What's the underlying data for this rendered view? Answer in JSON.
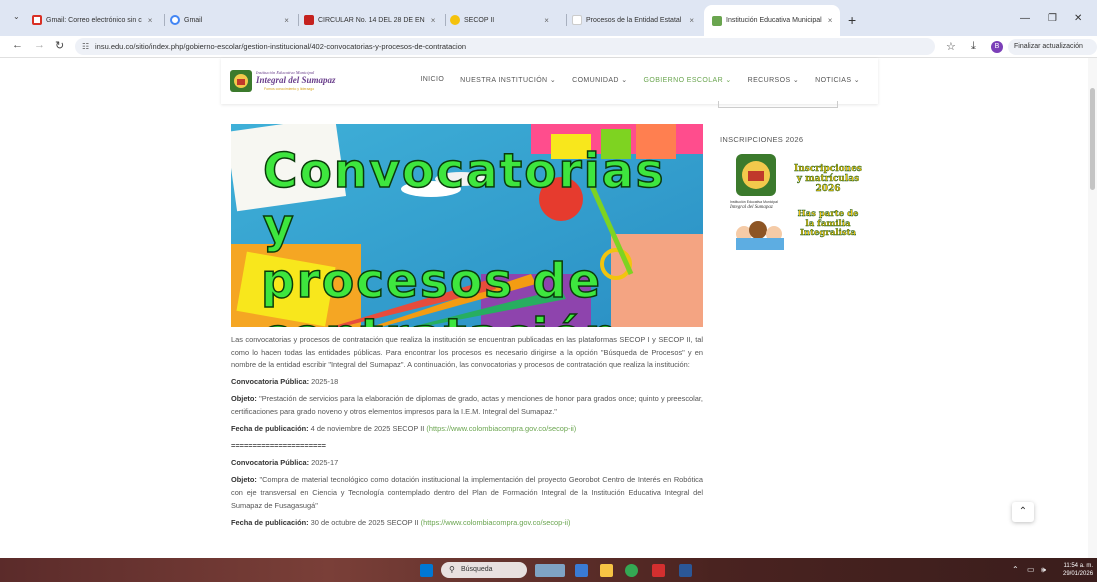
{
  "browser": {
    "tabs": [
      {
        "title": "Gmail: Correo electrónico sin c",
        "color": "#d93025"
      },
      {
        "title": "Gmail",
        "color": "#4285f4"
      },
      {
        "title": "CIRCULAR No. 14 DEL 28 DE EN",
        "color": "#c5221f"
      },
      {
        "title": "SECOP II",
        "color": "#f4c20d"
      },
      {
        "title": "Procesos de la Entidad Estatal",
        "color": "#ffffff"
      },
      {
        "title": "Institución Educativa Municipal",
        "color": "#6aa54f"
      }
    ],
    "close_glyph": "×",
    "new_tab_glyph": "+",
    "url": "insu.edu.co/sitio/index.php/gobierno-escolar/gestion-institucional/402-convocatorias-y-procesos-de-contratacion",
    "profile_initial": "B",
    "update_label": "Finalizar actualización"
  },
  "site": {
    "logo_title": "Institución Educativa Municipal",
    "logo_name": "Integral del Sumapaz",
    "logo_tagline": "Fomos conocimiento y liderazgo",
    "nav": [
      "INICIO",
      "NUESTRA INSTITUCIÓN ⌄",
      "COMUNIDAD ⌄",
      "GOBIERNO ESCOLAR ⌄",
      "RECURSOS ⌄",
      "NOTICIAS ⌄"
    ],
    "active_nav_index": 3,
    "accent_color": "#6aa54f"
  },
  "hero": {
    "line1": "Convocatorias y",
    "line2": "procesos de",
    "line3": "contratación"
  },
  "article": {
    "intro": "Las convocatorias y procesos de contratación que realiza la institución se encuentran publicadas en las plataformas SECOP I y SECOP II, tal como lo hacen todas las entidades públicas. Para encontrar los procesos es necesario dirigirse a la opción \"Búsqueda de Procesos\" y en nombre de la entidad escribir \"Integral del Sumapaz\". A continuación, las convocatorias y procesos de contratación que realiza la institución:",
    "items": [
      {
        "conv_label": "Convocatoria Pública:",
        "conv_value": " 2025-18",
        "obj_label": "Objeto:",
        "obj_value": " \"Prestación de servicios para la elaboración de diplomas de grado, actas y menciones de honor para grados once; quinto y preescolar, certificaciones para grado noveno y otros elementos impresos para la I.E.M. Integral del Sumapaz.\"",
        "date_label": "Fecha de publicación:",
        "date_value": " 4 de noviembre de 2025 SECOP II ",
        "link": "(https://www.colombiacompra.gov.co/secop-ii)"
      },
      {
        "conv_label": "Convocatoria Pública:",
        "conv_value": " 2025-17",
        "obj_label": "Objeto:",
        "obj_value": " \"Compra de material tecnológico como dotación institucional la implementación del proyecto Georobot Centro de Interés en Robótica con eje transversal en Ciencia y Tecnología contemplado dentro del Plan de Formación Integral de la Institución Educativa Integral del Sumapaz de Fusagasugá\"",
        "date_label": "Fecha de publicación:",
        "date_value": " 30 de octubre de 2025 SECOP II ",
        "link": "(https://www.colombiacompra.gov.co/secop-ii)"
      }
    ],
    "separator": "======================"
  },
  "sidebar": {
    "title": "INSCRIPCIONES 2026",
    "promo_line1": "Inscripciones",
    "promo_line2": "y matrículas",
    "promo_line3": "2026",
    "promo_line4": "Has parte de",
    "promo_line5": "la familia",
    "promo_line6": "Integralista",
    "promo_school": "Institución Educativa Municipal",
    "promo_school2": "Integral del Sumapaz"
  },
  "taskbar": {
    "search_placeholder": "Búsqueda",
    "time": "11:54 a. m.",
    "date": "29/01/2026"
  }
}
